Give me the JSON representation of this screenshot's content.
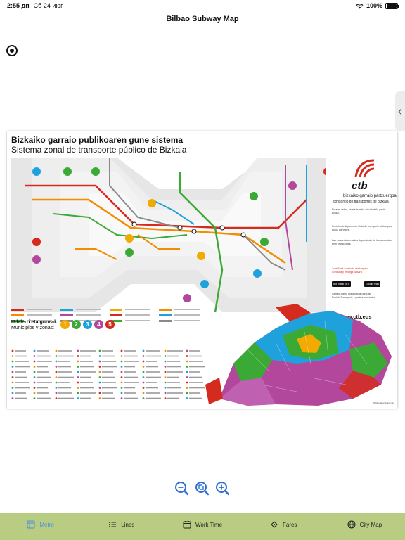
{
  "status_bar": {
    "time": "2:55 дп",
    "date": "Сб 24 июг.",
    "battery_pct": "100%",
    "battery_level": 1.0
  },
  "nav": {
    "title": "Bilbao Subway Map"
  },
  "poster": {
    "title_basque": "Bizkaiko garraio publikoaren gune sistema",
    "title_spanish": "Sistema zonal de transporte público de Bizkaia",
    "brand": {
      "name": "ctb",
      "subtitle_basque": "bizkaiko garraio partzuergoa",
      "subtitle_spanish": "consorcio de transportes de bizkaia",
      "panel_text_1": "Bidaian zehar, bidaia-txartela edo txartela gorde ezazu.",
      "panel_text_2": "Se deberá disponer de título de transporte válido para todos los viajes.",
      "panel_text_3": "Las zonas atravesadas dependerán de los recorridos entre estaciones.",
      "red_text": "Zure Barik kontsulta eta kargatu",
      "red_text_2": "Consulta y recarga tu Barik",
      "app_badge_1": "App Barik NFC",
      "app_badge_2": "Google Play",
      "info_basque": "Garraio-sarea eta akatsak puntuak",
      "info_spanish": "Red de Transporte y puntos asociados",
      "url": "www.ctb.eus"
    },
    "zones": {
      "title_basque": "Udalerri eta guneak:",
      "title_spanish": "Municipios y zonas:",
      "items": [
        {
          "label": "1",
          "color": "#f2a900"
        },
        {
          "label": "2",
          "color": "#3aa935"
        },
        {
          "label": "3",
          "color": "#1fa2dc"
        },
        {
          "label": "4",
          "color": "#b2479b"
        },
        {
          "label": "5",
          "color": "#d52b1e"
        }
      ]
    },
    "footnote": "2023ko abenduaren 1a"
  },
  "zoom": {
    "out": "zoom-out",
    "reset": "zoom-reset",
    "in": "zoom-in"
  },
  "tabs": [
    {
      "label": "Metro",
      "icon": "metro-icon",
      "active": true
    },
    {
      "label": "Lines",
      "icon": "lines-icon",
      "active": false
    },
    {
      "label": "Work Time",
      "icon": "calendar-icon",
      "active": false
    },
    {
      "label": "Fares",
      "icon": "ticket-icon",
      "active": false
    },
    {
      "label": "City Map",
      "icon": "globe-icon",
      "active": false
    }
  ],
  "colors": {
    "tab_bar": "#b8cc82",
    "active_tab": "#4a90d9",
    "brand_red": "#d52b1e",
    "line_orange": "#f28c00",
    "line_red": "#d52b1e",
    "line_green": "#3aa935",
    "line_blue": "#1fa2dc",
    "line_purple": "#b2479b",
    "line_grey": "#8a8a8a"
  }
}
